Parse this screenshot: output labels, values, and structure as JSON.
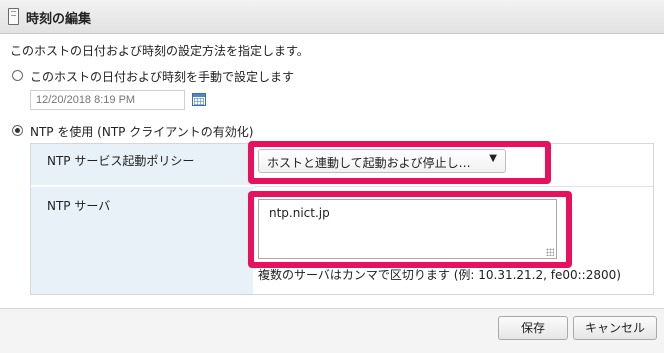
{
  "dialog": {
    "title": "時刻の編集",
    "description": "このホストの日付および時刻の設定方法を指定します。"
  },
  "manual_option": {
    "label": "このホストの日付および時刻を手動で設定します",
    "selected": false,
    "datetime_placeholder": "12/20/2018 8:19 PM"
  },
  "ntp_option": {
    "label": "NTP を使用 (NTP クライアントの有効化)",
    "selected": true,
    "policy_label": "NTP サービス起動ポリシー",
    "policy_value": "ホストと連動して起動および停止し…",
    "server_label": "NTP サーバ",
    "server_value": "ntp.nict.jp",
    "server_hint": "複数のサーバはカンマで区切ります (例: 10.31.21.2, fe00::2800)"
  },
  "footer": {
    "save_label": "保存",
    "cancel_label": "キャンセル"
  },
  "icons": {
    "title": "document-icon",
    "calendar": "calendar-icon",
    "dropdown": "chevron-down-icon"
  },
  "colors": {
    "highlight": "#e8115e",
    "label_bg": "#e8f0f8"
  }
}
